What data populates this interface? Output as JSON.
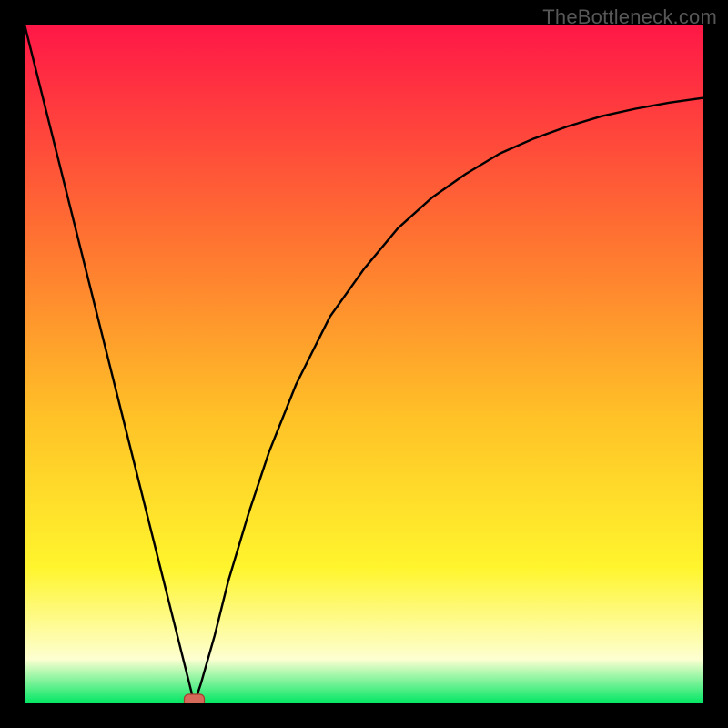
{
  "watermark": "TheBottleneck.com",
  "colors": {
    "outer_bg": "#000000",
    "grad_top": "#ff1747",
    "grad_upper": "#ff6e32",
    "grad_mid": "#ffc227",
    "grad_lower": "#fff52d",
    "grad_pale": "#fdffd1",
    "grad_bottom": "#00e763",
    "curve": "#000000",
    "marker_fill": "#d56a5b",
    "marker_stroke": "#a63e2f"
  },
  "chart_data": {
    "type": "line",
    "title": "",
    "xlabel": "",
    "ylabel": "",
    "xlim": [
      0,
      100
    ],
    "ylim": [
      0,
      100
    ],
    "series": [
      {
        "name": "bottleneck-curve",
        "x": [
          0,
          5,
          10,
          15,
          20,
          22,
          24,
          25,
          26,
          28,
          30,
          33,
          36,
          40,
          45,
          50,
          55,
          60,
          65,
          70,
          75,
          80,
          85,
          90,
          95,
          100
        ],
        "values": [
          100,
          80,
          60,
          40,
          20,
          12,
          4,
          0,
          3,
          10,
          18,
          28,
          37,
          47,
          57,
          64,
          70,
          74.5,
          78,
          81,
          83.2,
          85,
          86.5,
          87.6,
          88.5,
          89.2
        ]
      }
    ],
    "marker": {
      "x": 25,
      "y": 0
    },
    "gradient_stops": [
      {
        "offset": 0.0,
        "key": "grad_top"
      },
      {
        "offset": 0.3,
        "key": "grad_upper"
      },
      {
        "offset": 0.58,
        "key": "grad_mid"
      },
      {
        "offset": 0.8,
        "key": "grad_lower"
      },
      {
        "offset": 0.935,
        "key": "grad_pale"
      },
      {
        "offset": 1.0,
        "key": "grad_bottom"
      }
    ]
  }
}
